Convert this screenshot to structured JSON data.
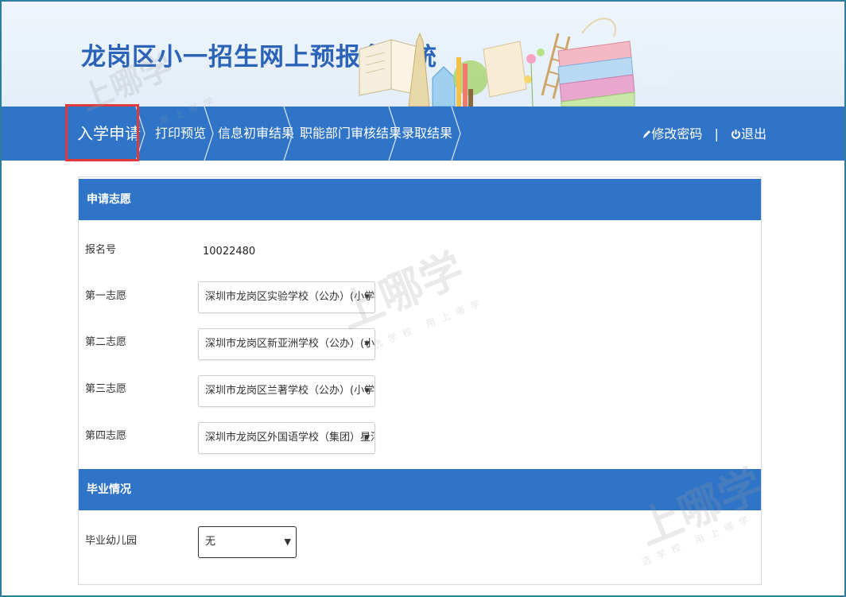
{
  "header": {
    "title": "龙岗区小一招生网上预报名系统"
  },
  "nav": {
    "items": [
      {
        "label": "入学申请",
        "active": true
      },
      {
        "label": "打印预览"
      },
      {
        "label": "信息初审结果"
      },
      {
        "label": "职能部门审核结果"
      },
      {
        "label": "录取结果"
      }
    ],
    "change_password": "修改密码",
    "separator": "|",
    "logout": "退出",
    "accent": "#2f74c7",
    "highlight": "#e03a3a"
  },
  "application": {
    "section_title": "申请志愿",
    "reg_no_label": "报名号",
    "reg_no_value": "10022480",
    "choices": [
      {
        "label": "第一志愿",
        "value": "深圳市龙岗区实验学校（公办）(小学部)"
      },
      {
        "label": "第二志愿",
        "value": "深圳市龙岗区新亚洲学校（公办）(小学部)"
      },
      {
        "label": "第三志愿",
        "value": "深圳市龙岗区兰著学校（公办）(小学部)"
      },
      {
        "label": "第四志愿",
        "value": "深圳市龙岗区外国语学校（集团）星河学..."
      }
    ]
  },
  "graduation": {
    "section_title": "毕业情况",
    "kindergarten_label": "毕业幼儿园",
    "kindergarten_value": "无"
  },
  "watermarks": {
    "brand": "上哪学",
    "sub": "用上哪学",
    "sub2": "选学校 用上哪学"
  },
  "icons": {
    "pencil": "pencil-icon",
    "power": "power-icon",
    "caret": "caret-down-icon"
  }
}
